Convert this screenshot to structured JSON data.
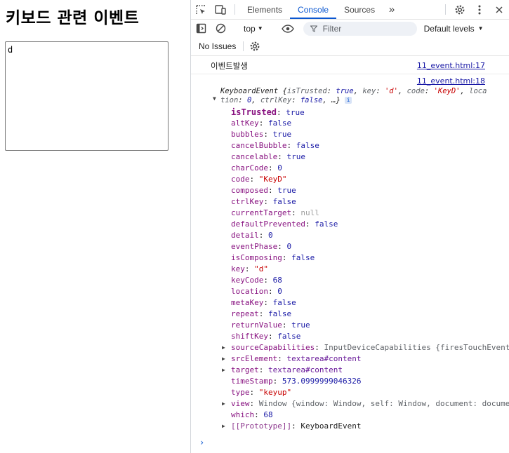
{
  "page": {
    "title": "키보드 관련 이벤트",
    "textarea_value": "d"
  },
  "devtools": {
    "tabs": [
      {
        "label": "Elements",
        "active": false
      },
      {
        "label": "Console",
        "active": true
      },
      {
        "label": "Sources",
        "active": false
      }
    ],
    "toolbar": {
      "context": "top",
      "filter_placeholder": "Filter",
      "levels": "Default levels"
    },
    "issues_label": "No Issues",
    "console": {
      "log1": {
        "text": "이벤트발생",
        "source": "11_event.html:17"
      },
      "log2": {
        "source": "11_event.html:18"
      },
      "object": {
        "class_name": "KeyboardEvent",
        "preview": [
          {
            "key": "isTrusted",
            "value": "true",
            "kind": "bool"
          },
          {
            "key": "key",
            "value": "'d'",
            "kind": "str"
          },
          {
            "key": "code",
            "value": "'KeyD'",
            "kind": "str"
          },
          {
            "key": "location",
            "value": "0",
            "kind": "num"
          },
          {
            "key": "ctrlKey",
            "value": "false",
            "kind": "bool"
          }
        ],
        "ellipsis": "…",
        "properties": [
          {
            "key": "isTrusted",
            "value": "true",
            "kind": "bool",
            "bold": true
          },
          {
            "key": "altKey",
            "value": "false",
            "kind": "bool"
          },
          {
            "key": "bubbles",
            "value": "true",
            "kind": "bool"
          },
          {
            "key": "cancelBubble",
            "value": "false",
            "kind": "bool"
          },
          {
            "key": "cancelable",
            "value": "true",
            "kind": "bool"
          },
          {
            "key": "charCode",
            "value": "0",
            "kind": "num"
          },
          {
            "key": "code",
            "value": "\"KeyD\"",
            "kind": "str"
          },
          {
            "key": "composed",
            "value": "true",
            "kind": "bool"
          },
          {
            "key": "ctrlKey",
            "value": "false",
            "kind": "bool"
          },
          {
            "key": "currentTarget",
            "value": "null",
            "kind": "null"
          },
          {
            "key": "defaultPrevented",
            "value": "false",
            "kind": "bool"
          },
          {
            "key": "detail",
            "value": "0",
            "kind": "num"
          },
          {
            "key": "eventPhase",
            "value": "0",
            "kind": "num"
          },
          {
            "key": "isComposing",
            "value": "false",
            "kind": "bool"
          },
          {
            "key": "key",
            "value": "\"d\"",
            "kind": "str"
          },
          {
            "key": "keyCode",
            "value": "68",
            "kind": "num"
          },
          {
            "key": "location",
            "value": "0",
            "kind": "num"
          },
          {
            "key": "metaKey",
            "value": "false",
            "kind": "bool"
          },
          {
            "key": "repeat",
            "value": "false",
            "kind": "bool"
          },
          {
            "key": "returnValue",
            "value": "true",
            "kind": "bool"
          },
          {
            "key": "shiftKey",
            "value": "false",
            "kind": "bool"
          },
          {
            "key": "sourceCapabilities",
            "value": "InputDeviceCapabilities {firesTouchEvents",
            "kind": "dim",
            "expandable": true
          },
          {
            "key": "srcElement",
            "value": "textarea#content",
            "kind": "label",
            "expandable": true
          },
          {
            "key": "target",
            "value": "textarea#content",
            "kind": "label",
            "expandable": true
          },
          {
            "key": "timeStamp",
            "value": "573.0999999046326",
            "kind": "num"
          },
          {
            "key": "type",
            "value": "\"keyup\"",
            "kind": "str"
          },
          {
            "key": "view",
            "value": "Window {window: Window, self: Window, document: document",
            "kind": "dim",
            "expandable": true
          },
          {
            "key": "which",
            "value": "68",
            "kind": "num"
          },
          {
            "key": "[[Prototype]]",
            "value": "KeyboardEvent",
            "kind": "obj",
            "expandable": true,
            "dimkey": true
          }
        ]
      }
    }
  },
  "colors": {
    "accent": "#0b57d0",
    "property_key": "#881280",
    "string_value": "#c80000",
    "bool_value": "#1a1aa6"
  }
}
